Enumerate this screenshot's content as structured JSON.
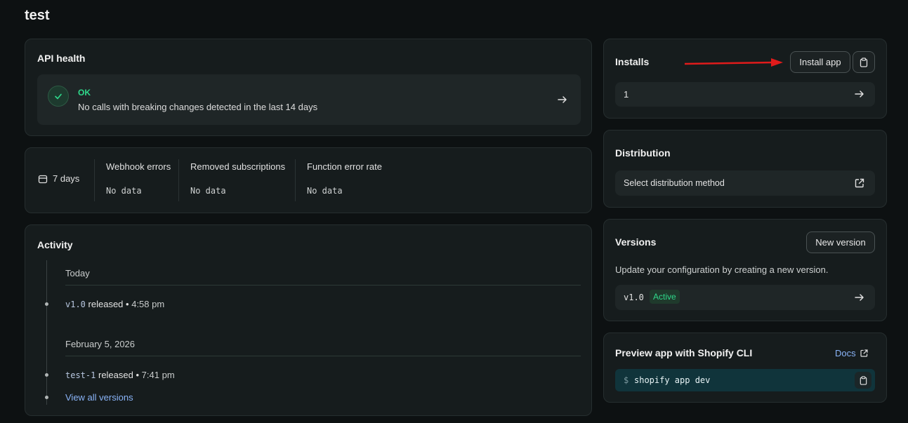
{
  "page": {
    "title": "test"
  },
  "api_health": {
    "title": "API health",
    "status": "OK",
    "message": "No calls with breaking changes detected in the last 14 days"
  },
  "metrics": {
    "period": "7 days",
    "columns": [
      {
        "label": "Webhook errors",
        "value": "No data"
      },
      {
        "label": "Removed subscriptions",
        "value": "No data"
      },
      {
        "label": "Function error rate",
        "value": "No data"
      }
    ]
  },
  "activity": {
    "title": "Activity",
    "groups": [
      {
        "date": "Today",
        "version": "v1.0",
        "action": "released",
        "separator": "•",
        "time": "4:58 pm"
      },
      {
        "date": "February 5, 2026",
        "version": "test-1",
        "action": "released",
        "separator": "•",
        "time": "7:41 pm"
      }
    ],
    "view_all": "View all versions"
  },
  "installs": {
    "title": "Installs",
    "install_button": "Install app",
    "count": "1"
  },
  "distribution": {
    "title": "Distribution",
    "select_label": "Select distribution method"
  },
  "versions": {
    "title": "Versions",
    "new_button": "New version",
    "description": "Update your configuration by creating a new version.",
    "current": "v1.0",
    "badge": "Active"
  },
  "preview": {
    "title": "Preview app with Shopify CLI",
    "docs": "Docs",
    "prompt": "$",
    "command": "shopify app dev"
  },
  "colors": {
    "ok_green": "#2fd98b",
    "link_blue": "#8ab4f8",
    "annotation_red": "#e01b1b",
    "active_badge_bg": "#1f3a2c"
  }
}
